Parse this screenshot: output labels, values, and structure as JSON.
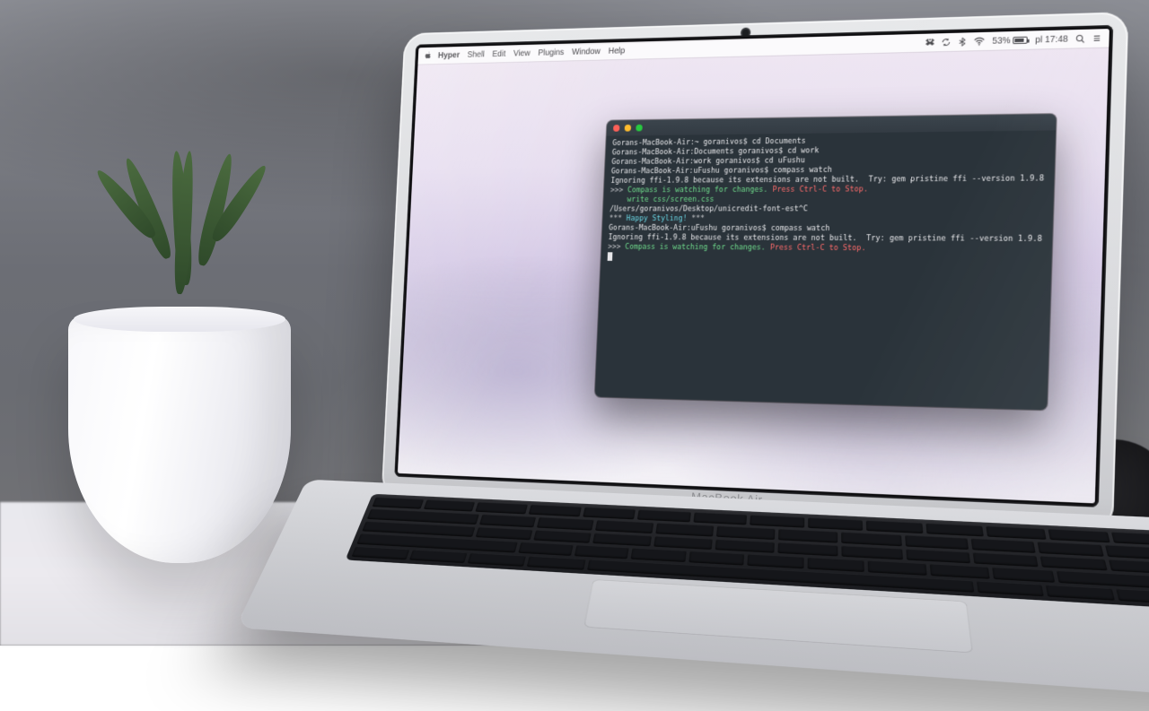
{
  "laptop": {
    "brand": "MacBook Air"
  },
  "menubar": {
    "app": "Hyper",
    "items": [
      "Shell",
      "Edit",
      "View",
      "Plugins",
      "Window",
      "Help"
    ],
    "status": {
      "battery_pct": "53%",
      "clock": "pl 17:48"
    }
  },
  "terminal": {
    "lines": [
      {
        "segments": [
          {
            "t": "Gorans-MacBook-Air:~ goranivos$ cd Documents"
          }
        ]
      },
      {
        "segments": [
          {
            "t": "Gorans-MacBook-Air:Documents goranivos$ cd work"
          }
        ]
      },
      {
        "segments": [
          {
            "t": "Gorans-MacBook-Air:work goranivos$ cd uFushu"
          }
        ]
      },
      {
        "segments": [
          {
            "t": "Gorans-MacBook-Air:uFushu goranivos$ compass watch"
          }
        ]
      },
      {
        "segments": [
          {
            "t": "Ignoring ffi-1.9.8 because its extensions are not built.  Try: gem pristine ffi --version 1.9.8"
          }
        ]
      },
      {
        "segments": [
          {
            "t": ">>> ",
            "c": "c-dim"
          },
          {
            "t": "Compass is watching for changes. ",
            "c": "c-green"
          },
          {
            "t": "Press Ctrl-C to Stop.",
            "c": "c-red"
          }
        ]
      },
      {
        "segments": [
          {
            "t": "    write css/screen.css",
            "c": "c-green"
          }
        ]
      },
      {
        "segments": [
          {
            "t": "/Users/goranivos/Desktop/unicredit-font-est^C"
          }
        ]
      },
      {
        "segments": [
          {
            "t": "*** ",
            "c": "c-dim"
          },
          {
            "t": "Happy Styling!",
            "c": "c-cyan"
          },
          {
            "t": " ***",
            "c": "c-dim"
          }
        ]
      },
      {
        "segments": [
          {
            "t": "Gorans-MacBook-Air:uFushu goranivos$ compass watch"
          }
        ]
      },
      {
        "segments": [
          {
            "t": "Ignoring ffi-1.9.8 because its extensions are not built.  Try: gem pristine ffi --version 1.9.8"
          }
        ]
      },
      {
        "segments": [
          {
            "t": ">>> ",
            "c": "c-dim"
          },
          {
            "t": "Compass is watching for changes. ",
            "c": "c-green"
          },
          {
            "t": "Press Ctrl-C to Stop.",
            "c": "c-red"
          }
        ]
      }
    ]
  }
}
